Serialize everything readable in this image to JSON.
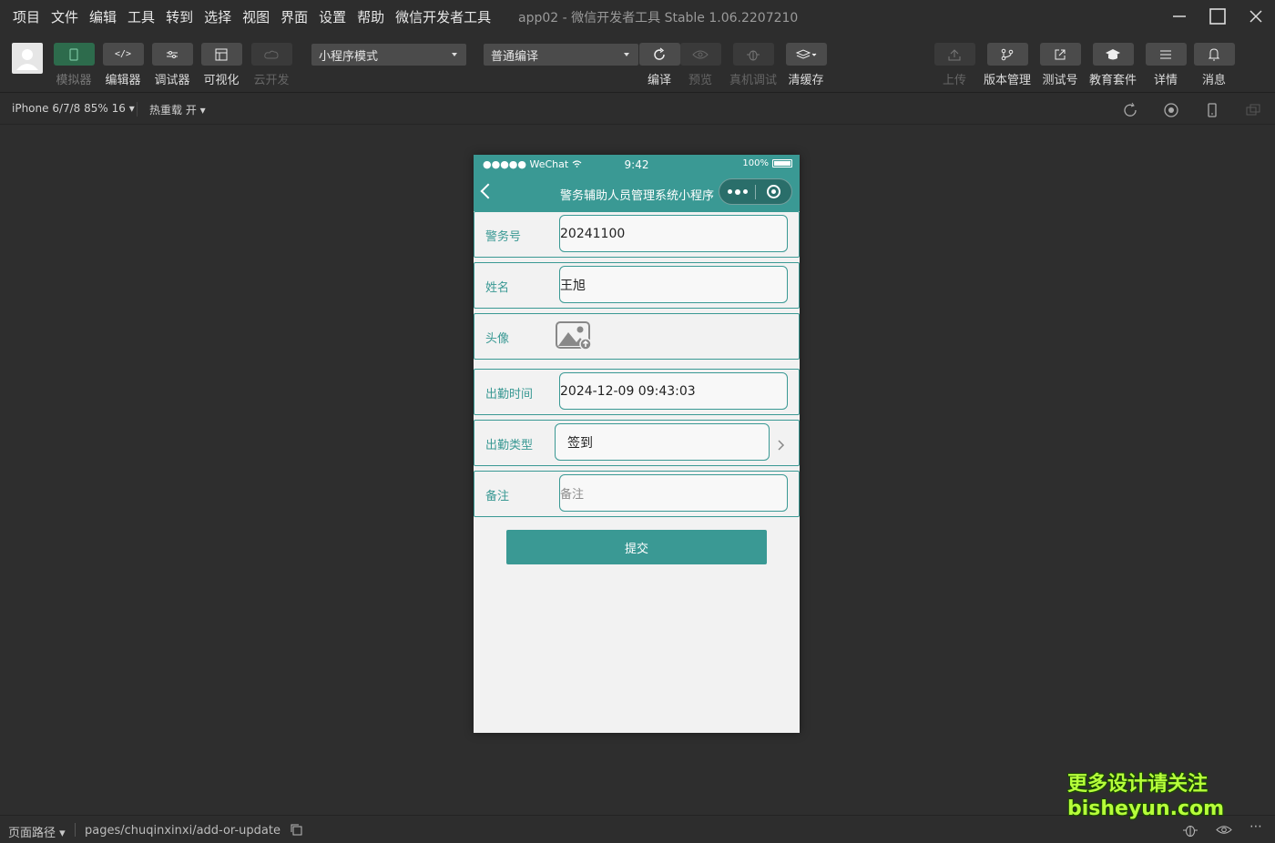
{
  "menubar": {
    "items": [
      "项目",
      "文件",
      "编辑",
      "工具",
      "转到",
      "选择",
      "视图",
      "界面",
      "设置",
      "帮助",
      "微信开发者工具"
    ],
    "window_title": "app02 - 微信开发者工具 Stable 1.06.2207210"
  },
  "toolbar": {
    "left_buttons": [
      {
        "label": "模拟器",
        "icon": "phone-icon",
        "state": "active-disabled"
      },
      {
        "label": "编辑器",
        "icon": "code-icon",
        "state": "normal"
      },
      {
        "label": "调试器",
        "icon": "debug-icon",
        "state": "normal"
      },
      {
        "label": "可视化",
        "icon": "layout-icon",
        "state": "normal"
      },
      {
        "label": "云开发",
        "icon": "cloud-icon",
        "state": "disabled"
      }
    ],
    "mode_select": "小程序模式",
    "compile_select": "普通编译",
    "center_buttons": [
      {
        "label": "编译",
        "icon": "refresh-icon"
      },
      {
        "label": "预览",
        "icon": "eye-icon"
      },
      {
        "label": "真机调试",
        "icon": "bug-icon"
      },
      {
        "label": "清缓存",
        "icon": "layers-icon"
      }
    ],
    "right_buttons": [
      {
        "label": "上传",
        "icon": "upload-icon"
      },
      {
        "label": "版本管理",
        "icon": "branch-icon"
      },
      {
        "label": "测试号",
        "icon": "external-link-icon"
      },
      {
        "label": "教育套件",
        "icon": "graduation-cap-icon"
      },
      {
        "label": "详情",
        "icon": "menu-icon"
      },
      {
        "label": "消息",
        "icon": "bell-icon"
      }
    ]
  },
  "subbar": {
    "device": "iPhone 6/7/8 85% 16",
    "hot_reload": "热重载 开"
  },
  "phone": {
    "status": {
      "carrier": "●●●●● WeChat",
      "time": "9:42",
      "battery": "100%"
    },
    "nav_title": "警务辅助人员管理系统小程序",
    "fields": [
      {
        "label": "警务号",
        "value": "20241100"
      },
      {
        "label": "姓名",
        "value": "王旭"
      },
      {
        "label": "头像",
        "value": ""
      },
      {
        "label": "出勤时间",
        "value": "2024-12-09 09:43:03"
      },
      {
        "label": "出勤类型",
        "value": "签到"
      },
      {
        "label": "备注",
        "placeholder": "备注"
      }
    ],
    "submit_label": "提交"
  },
  "bottombar": {
    "path_label": "页面路径",
    "path": "pages/chuqinxinxi/add-or-update"
  },
  "watermark": {
    "line1": "更多设计请关注",
    "line2": "bisheyun.com"
  },
  "colors": {
    "theme": "#3a9994",
    "window_bg": "#2d2d2d",
    "watermark": "#b6ff3a"
  }
}
